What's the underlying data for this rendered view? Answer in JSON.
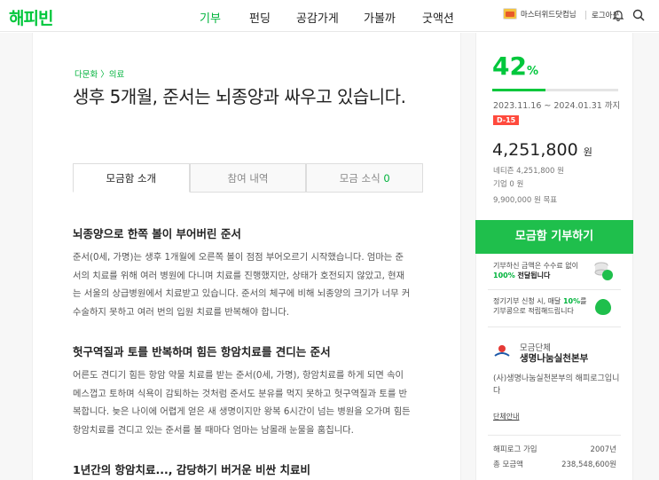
{
  "header": {
    "logo": "해피빈",
    "nav": [
      {
        "label": "기부"
      },
      {
        "label": "펀딩"
      },
      {
        "label": "공감가게"
      },
      {
        "label": "가볼까"
      },
      {
        "label": "굿액션"
      }
    ],
    "user": "마스터위드닷컴님",
    "logout": "로그아웃",
    "accent": "#00c73c"
  },
  "article": {
    "category": "다문화 〉의료",
    "title": "생후 5개월, 준서는 뇌종양과 싸우고 있습니다.",
    "tabs": [
      {
        "label": "모금함 소개"
      },
      {
        "label": "참여 내역"
      },
      {
        "label": "모금 소식",
        "count": "0"
      }
    ],
    "sections": [
      {
        "heading": "뇌종양으로 한쪽 볼이 부어버린 준서",
        "lines": [
          "준서(0세, 가명)는 생후 1개월에 오른쪽 볼이 점점 부어오르기 시작했습니다. 엄마는 준",
          "서의 치료를 위해 여러 병원에 다니며 치료를 진행했지만, 상태가 호전되지 않았고, 현재",
          "는 서울의 상급병원에서 치료받고 있습니다. 준서의 체구에 비해 뇌종양의 크기가 너무 커",
          "수술하지 못하고 여러 번의 입원 치료를 반복해야 합니다."
        ]
      },
      {
        "heading": "헛구역질과 토를 반복하며 힘든 항암치료를 견디는 준서",
        "lines": [
          "어른도 견디기 힘든 항암 약물 치료를 받는 준서(0세, 가명), 항암치료를 하게 되면 속이",
          "메스껍고 토하며 식욕이 감퇴하는 것처럼 준서도 분유를 먹지 못하고 헛구역질과 토를 반",
          "복합니다. 늦은 나이에 어렵게 얻은 새 생명이지만 왕복 6시간이 넘는 병원을 오가며 힘든",
          "항암치료를 견디고 있는 준서를 볼 때마다 엄마는 남몰래 눈물을 훔칩니다."
        ]
      },
      {
        "heading": "1년간의 항암치료..., 감당하기 버거운 비싼 치료비"
      }
    ]
  },
  "panel": {
    "percent": "42",
    "percent_unit": "%",
    "progress": 0.42,
    "dates": "2023.11.16 ~ 2024.01.31 까지",
    "dday": "D-15",
    "amount": "4,251,800",
    "amount_unit": "원",
    "netizen": "네티즌 4,251,800 원",
    "company": "기업 0 원",
    "goal": "9,900,000 원 목표",
    "donate": "모금함 기부하기",
    "info1_a": "기부하신 금액은 수수료 없이",
    "info1_b": "100%",
    "info1_c": " 전달됩니다",
    "info2_a": "정기기부 신청 시, 매달 ",
    "info2_b": "10%",
    "info2_c": "를",
    "info2_d": "기부콩으로 적립해드립니다",
    "org_label": "모금단체",
    "org_name": "생명나눔실천본부",
    "org_desc": "(사)생명나눔실천본부의 해피로그입니다",
    "org_link": "단체안내",
    "stats": [
      {
        "k": "해피로그 가입",
        "v": "2007년"
      },
      {
        "k": "총 모금액",
        "v": "238,548,600원"
      }
    ]
  }
}
